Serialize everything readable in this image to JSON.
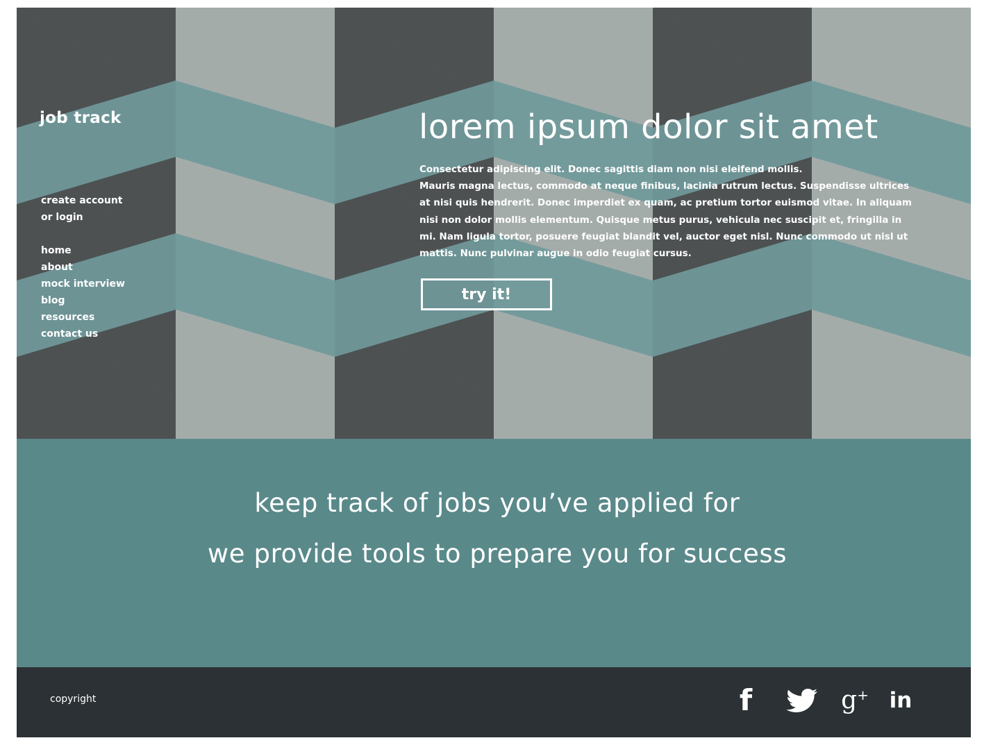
{
  "brand": {
    "name": "job track"
  },
  "nav": {
    "account": [
      "create account",
      "or login"
    ],
    "items": [
      "home",
      "about",
      "mock interview",
      "blog",
      "resources",
      "contact us"
    ]
  },
  "hero": {
    "headline": "lorem ipsum dolor sit amet",
    "body": "Consectetur adipiscing elit. Donec sagittis diam non nisi eleifend mollis. Mauris magna lectus, commodo at neque finibus, lacinia rutrum lectus. Suspendisse ultrices at nisi quis hendrerit. Donec imperdiet ex quam, ac pretium tortor euismod vitae. In aliquam nisi non dolor mollis elementum. Quisque metus purus, vehicula nec suscipit et, fringilla in mi. Nam ligula tortor, posuere feugiat blandit vel, auctor eget nisl. Nunc commodo ut nisl ut mattis. Nunc pulvinar augue in odio feugiat cursus.",
    "body_line_1": "Consectetur adipiscing elit. Donec sagittis diam non nisi eleifend mollis.",
    "body_rest": "Mauris magna lectus, commodo at neque finibus, lacinia rutrum lectus. Suspendisse ultrices at nisi quis hendrerit. Donec imperdiet ex quam, ac pretium tortor euismod vitae. In aliquam nisi non dolor mollis elementum. Quisque metus purus, vehicula nec suscipit et, fringilla in mi. Nam ligula tortor, posuere feugiat blandit vel, auctor eget nisl. Nunc commodo ut nisl ut mattis. Nunc pulvinar augue in odio feugiat cursus.",
    "cta_label": "try it!"
  },
  "band": {
    "line_1": "keep track of jobs you’ve applied for",
    "line_2": "we provide tools to prepare you for success"
  },
  "footer": {
    "copyright": "copyright",
    "social": [
      "facebook-icon",
      "twitter-icon",
      "google-plus-icon",
      "linkedin-icon"
    ],
    "gplus_glyph": "g",
    "gplus_sup": "+",
    "linkedin_glyph": "in",
    "facebook_glyph": "f"
  },
  "colors": {
    "dark": "#4a4f50",
    "light": "#b7bfbd",
    "mid": "#7f8886",
    "teal": "#77a3a5",
    "band": "#5a898a",
    "footer": "#2b3134"
  }
}
